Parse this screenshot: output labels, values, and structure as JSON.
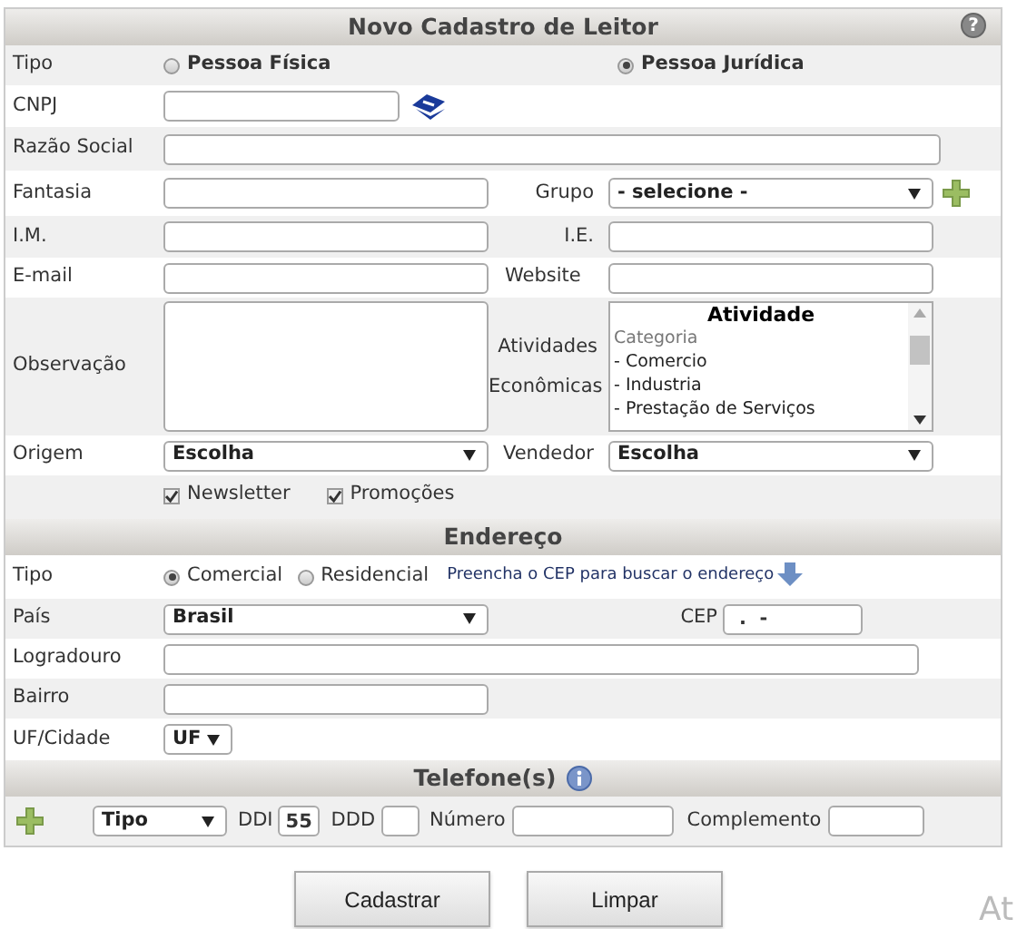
{
  "title": "Novo Cadastro de Leitor",
  "help": "?",
  "tipo": {
    "label": "Tipo",
    "options": [
      {
        "label": "Pessoa Física",
        "selected": false
      },
      {
        "label": "Pessoa Jurídica",
        "selected": true
      }
    ]
  },
  "cnpj": {
    "label": "CNPJ"
  },
  "razao_social": {
    "label": "Razão Social"
  },
  "fantasia": {
    "label": "Fantasia"
  },
  "grupo": {
    "label": "Grupo",
    "value": "- selecione -"
  },
  "im": {
    "label": "I.M."
  },
  "ie": {
    "label": "I.E."
  },
  "email": {
    "label": "E-mail"
  },
  "website": {
    "label": "Website"
  },
  "observacao": {
    "label": "Observação"
  },
  "atividades": {
    "label": "Atividades Econômicas",
    "header": "Atividade",
    "group": "Categoria",
    "items": [
      "- Comercio",
      "- Industria",
      "- Prestação de Serviços"
    ]
  },
  "origem": {
    "label": "Origem",
    "value": "Escolha"
  },
  "vendedor": {
    "label": "Vendedor",
    "value": "Escolha"
  },
  "checkboxes": [
    {
      "label": "Newsletter",
      "checked": true
    },
    {
      "label": "Promoções",
      "checked": true
    }
  ],
  "endereco": {
    "title": "Endereço",
    "tipo_label": "Tipo",
    "tipo_options": [
      {
        "label": "Comercial",
        "selected": true
      },
      {
        "label": "Residencial",
        "selected": false
      }
    ],
    "hint": "Preencha o CEP para buscar o endereço",
    "pais": {
      "label": "País",
      "value": "Brasil"
    },
    "cep": {
      "label": "CEP",
      "value": ".  -"
    },
    "logradouro": {
      "label": "Logradouro"
    },
    "bairro": {
      "label": "Bairro"
    },
    "uf_cidade": {
      "label": "UF/Cidade",
      "value": "UF"
    }
  },
  "telefones": {
    "title": "Telefone(s)",
    "tipo": "Tipo",
    "ddi_label": "DDI",
    "ddi": "55",
    "ddd_label": "DDD",
    "numero_label": "Número",
    "complemento_label": "Complemento"
  },
  "buttons": [
    "Cadastrar",
    "Limpar"
  ],
  "corner_text": "At"
}
